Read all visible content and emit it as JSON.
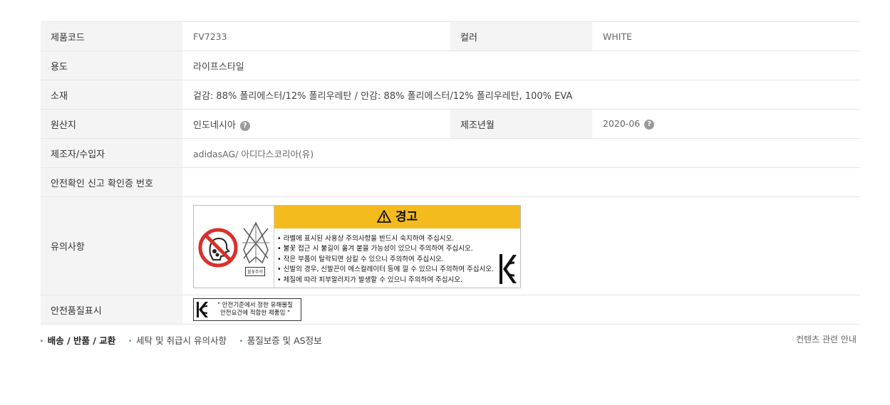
{
  "rows": {
    "product_code": {
      "label": "제품코드",
      "value": "FV7233"
    },
    "color": {
      "label": "컬러",
      "value": "WHITE"
    },
    "usage": {
      "label": "용도",
      "value": "라이프스타일"
    },
    "material": {
      "label": "소재",
      "value": "겉감: 88% 폴리에스터/12% 폴리우레탄 / 안감: 88% 폴리에스터/12% 폴리우레탄, 100% EVA"
    },
    "origin": {
      "label": "원산지",
      "value": "인도네시아"
    },
    "manufacture_date": {
      "label": "제조년월",
      "value": "2020-06"
    },
    "manufacturer": {
      "label": "제조자/수입자",
      "value": "adidasAG/ 아디다스코리아(유)"
    },
    "safety_cert": {
      "label": "안전확인 신고 확인증 번호",
      "value": ""
    },
    "caution": {
      "label": "유의사항"
    },
    "quality_mark": {
      "label": "안전품질표시"
    }
  },
  "warning_label": {
    "title": "경고",
    "sparkle_caption": "불꽃주의",
    "items": [
      "• 라벨에 표시된 사용상 주의사항을 반드시 숙지하여 주십시오.",
      "• 불꽃 접근 시 불길이 옮겨 붙을 가능성이 있으니 주의하여 주십시오.",
      "• 작은 부품이 탈락되면 삼킬 수 있으니 주의하여 주십시오.",
      "• 신발의 경우, 신발끈이 에스컬레이터 등에 낄 수 있으니 주의하여 주십시오.",
      "• 체질에 따라 피부알러지가 발생할 수 있으니 주의하여 주십시오."
    ]
  },
  "kc_label": {
    "line1": "\" 안전기준에서 정한 유해물질",
    "line2": "안전요건에 적합한 제품임 \""
  },
  "help_icon": "?",
  "footer": {
    "links": [
      "배송 / 반품 / 교환",
      "세탁 및 취급시 유의사항",
      "품질보증 및 AS정보"
    ],
    "content_guide": "컨텐츠 관련 안내"
  },
  "colors": {
    "warning_yellow": "#f4bb1f",
    "prohibit_red": "#d9302b",
    "dot_green": "#3a9a3a"
  }
}
